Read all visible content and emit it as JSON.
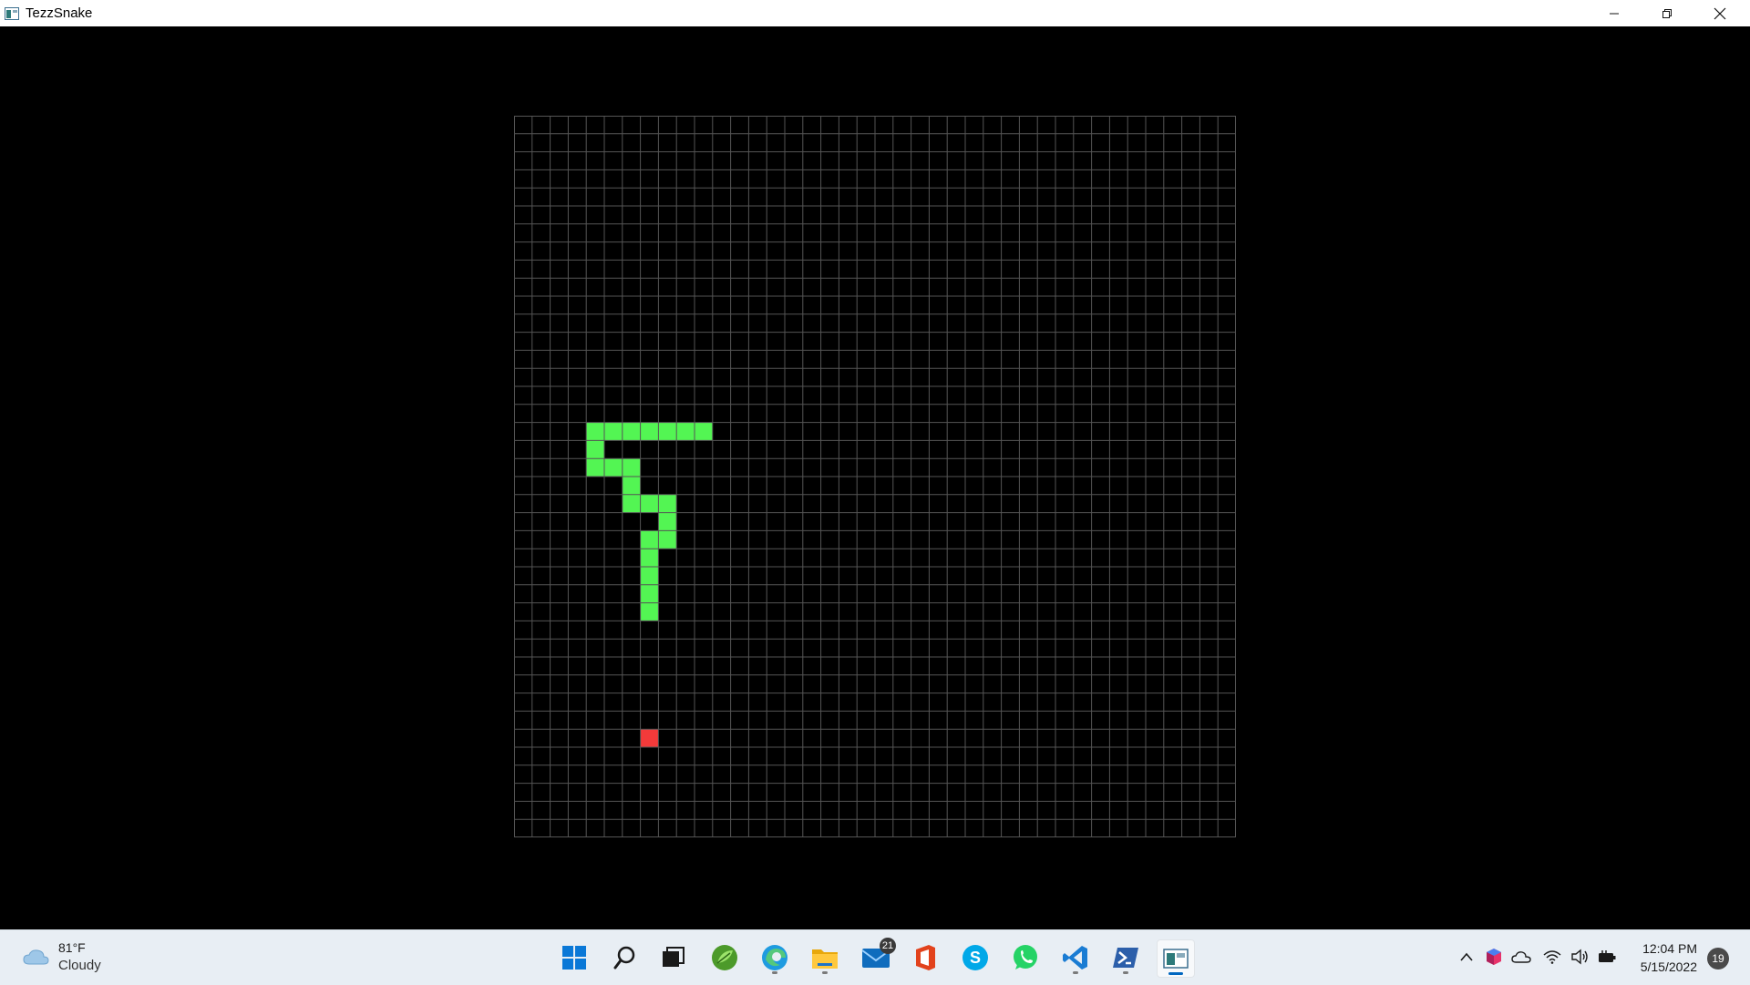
{
  "window": {
    "title": "TezzSnake",
    "controls": [
      "minimize",
      "restore",
      "close"
    ]
  },
  "game": {
    "grid_cols": 40,
    "grid_rows": 40,
    "grid_line_color": "#555555",
    "background": "#000000",
    "snake_color": "#53f553",
    "food_color": "#f33a3a",
    "snake_cells": [
      [
        4,
        17
      ],
      [
        5,
        17
      ],
      [
        6,
        17
      ],
      [
        7,
        17
      ],
      [
        8,
        17
      ],
      [
        9,
        17
      ],
      [
        10,
        17
      ],
      [
        4,
        18
      ],
      [
        4,
        19
      ],
      [
        5,
        19
      ],
      [
        6,
        19
      ],
      [
        6,
        20
      ],
      [
        6,
        21
      ],
      [
        7,
        21
      ],
      [
        8,
        21
      ],
      [
        8,
        22
      ],
      [
        7,
        23
      ],
      [
        8,
        23
      ],
      [
        7,
        24
      ],
      [
        7,
        25
      ],
      [
        7,
        26
      ],
      [
        7,
        27
      ]
    ],
    "food_cell": [
      7,
      34
    ]
  },
  "taskbar": {
    "weather": {
      "temp": "81°F",
      "condition": "Cloudy",
      "icon": "cloud-icon"
    },
    "apps": [
      {
        "name": "start",
        "icon": "windows-logo-icon"
      },
      {
        "name": "search",
        "icon": "search-icon"
      },
      {
        "name": "task-view",
        "icon": "task-view-icon"
      },
      {
        "name": "sourcetree",
        "icon": "leaf-app-icon"
      },
      {
        "name": "edge",
        "icon": "edge-icon"
      },
      {
        "name": "file-explorer",
        "icon": "folder-icon"
      },
      {
        "name": "mail",
        "icon": "mail-icon",
        "badge": "21"
      },
      {
        "name": "office",
        "icon": "office-icon"
      },
      {
        "name": "skype",
        "icon": "skype-icon"
      },
      {
        "name": "whatsapp",
        "icon": "whatsapp-icon"
      },
      {
        "name": "vscode",
        "icon": "vscode-icon"
      },
      {
        "name": "powershell",
        "icon": "powershell-icon"
      },
      {
        "name": "tezzsnake",
        "icon": "tezzsnake-app-icon"
      }
    ],
    "tray": {
      "icons": [
        "chevron-up-icon",
        "cube-app-icon",
        "onedrive-icon",
        "wifi-icon",
        "volume-icon",
        "battery-icon"
      ],
      "time": "12:04 PM",
      "date": "5/15/2022",
      "notification_count": "19"
    }
  }
}
